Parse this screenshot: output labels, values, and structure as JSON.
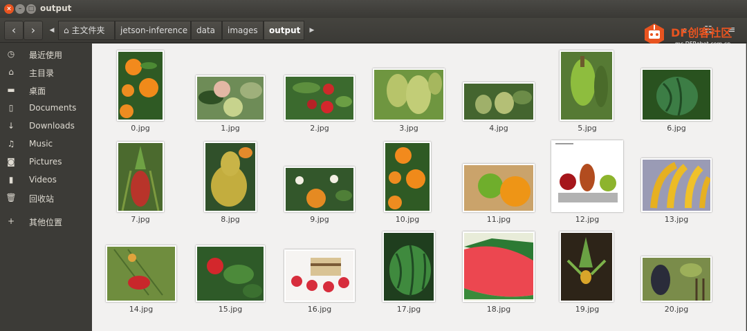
{
  "window": {
    "title": "output"
  },
  "nav": {
    "back": "back",
    "forward": "forward"
  },
  "breadcrumbs": [
    {
      "label": "主文件夹",
      "icon": "home-icon"
    },
    {
      "label": "jetson-inference"
    },
    {
      "label": "data"
    },
    {
      "label": "images"
    },
    {
      "label": "output",
      "active": true
    }
  ],
  "logo": {
    "main": "DF创客社区",
    "sub": "mc.DFRobot.com.cn"
  },
  "sidebar": {
    "items": [
      {
        "label": "最近使用",
        "icon": "clock-icon"
      },
      {
        "label": "主目录",
        "icon": "home-icon"
      },
      {
        "label": "桌面",
        "icon": "folder-icon"
      },
      {
        "label": "Documents",
        "icon": "document-icon"
      },
      {
        "label": "Downloads",
        "icon": "download-icon"
      },
      {
        "label": "Music",
        "icon": "music-icon"
      },
      {
        "label": "Pictures",
        "icon": "camera-icon"
      },
      {
        "label": "Videos",
        "icon": "video-icon"
      },
      {
        "label": "回收站",
        "icon": "trash-icon"
      },
      {
        "label": "其他位置",
        "icon": "plus-icon"
      }
    ]
  },
  "files": [
    {
      "name": "0.jpg",
      "subject": "oranges"
    },
    {
      "name": "1.jpg",
      "subject": "apples"
    },
    {
      "name": "2.jpg",
      "subject": "strawberries"
    },
    {
      "name": "3.jpg",
      "subject": "grapes"
    },
    {
      "name": "4.jpg",
      "subject": "pears"
    },
    {
      "name": "5.jpg",
      "subject": "bananas"
    },
    {
      "name": "6.jpg",
      "subject": "watermelon"
    },
    {
      "name": "7.jpg",
      "subject": "pineapple"
    },
    {
      "name": "8.jpg",
      "subject": "pear"
    },
    {
      "name": "9.jpg",
      "subject": "orange"
    },
    {
      "name": "10.jpg",
      "subject": "oranges"
    },
    {
      "name": "11.jpg",
      "subject": "apple and orange"
    },
    {
      "name": "12.jpg",
      "subject": "apples and pear"
    },
    {
      "name": "13.jpg",
      "subject": "bananas"
    },
    {
      "name": "14.jpg",
      "subject": "strawberry"
    },
    {
      "name": "15.jpg",
      "subject": "strawberry"
    },
    {
      "name": "16.jpg",
      "subject": "cake"
    },
    {
      "name": "17.jpg",
      "subject": "watermelon"
    },
    {
      "name": "18.jpg",
      "subject": "watermelon slices"
    },
    {
      "name": "19.jpg",
      "subject": "pineapple"
    },
    {
      "name": "20.jpg",
      "subject": "grapes"
    }
  ]
}
